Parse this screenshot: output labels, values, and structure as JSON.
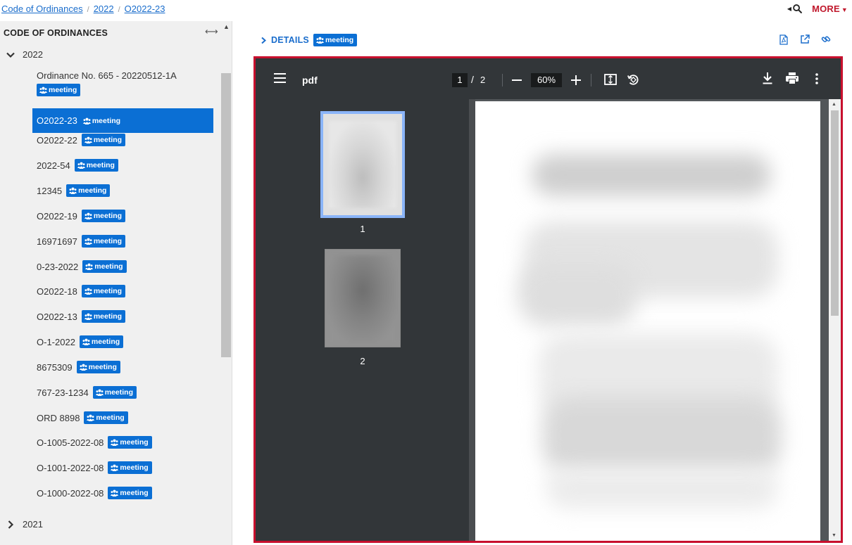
{
  "breadcrumb": {
    "items": [
      "Code of Ordinances",
      "2022",
      "O2022-23"
    ]
  },
  "topbar": {
    "more_label": "MORE"
  },
  "sidebar": {
    "header": "CODE OF ORDINANCES",
    "resize_glyph": "⟷",
    "folder_open": "2022",
    "folder_closed": "2021",
    "badge_label": "meeting",
    "items": [
      {
        "label": "Ordinance No. 665 - 20220512-1A"
      },
      {
        "label": "O2022-23"
      },
      {
        "label": "O2022-22"
      },
      {
        "label": "2022-54"
      },
      {
        "label": "12345"
      },
      {
        "label": "O2022-19"
      },
      {
        "label": "16971697"
      },
      {
        "label": "0-23-2022"
      },
      {
        "label": "O2022-18"
      },
      {
        "label": "O2022-13"
      },
      {
        "label": "O-1-2022"
      },
      {
        "label": "8675309"
      },
      {
        "label": "767-23-1234"
      },
      {
        "label": "ORD 8898"
      },
      {
        "label": "O-1005-2022-08"
      },
      {
        "label": "O-1001-2022-08"
      },
      {
        "label": "O-1000-2022-08"
      }
    ]
  },
  "details": {
    "label": "DETAILS",
    "badge": "meeting"
  },
  "viewer": {
    "title": "pdf",
    "current_page": "1",
    "page_sep": "/",
    "total_pages": "2",
    "zoom": "60%",
    "thumbnails": [
      "1",
      "2"
    ],
    "border_color": "#c8102e"
  },
  "colors": {
    "link": "#1a6dcc",
    "accent": "#0b6fd4",
    "more": "#c0182c",
    "toolbar": "#323639"
  }
}
